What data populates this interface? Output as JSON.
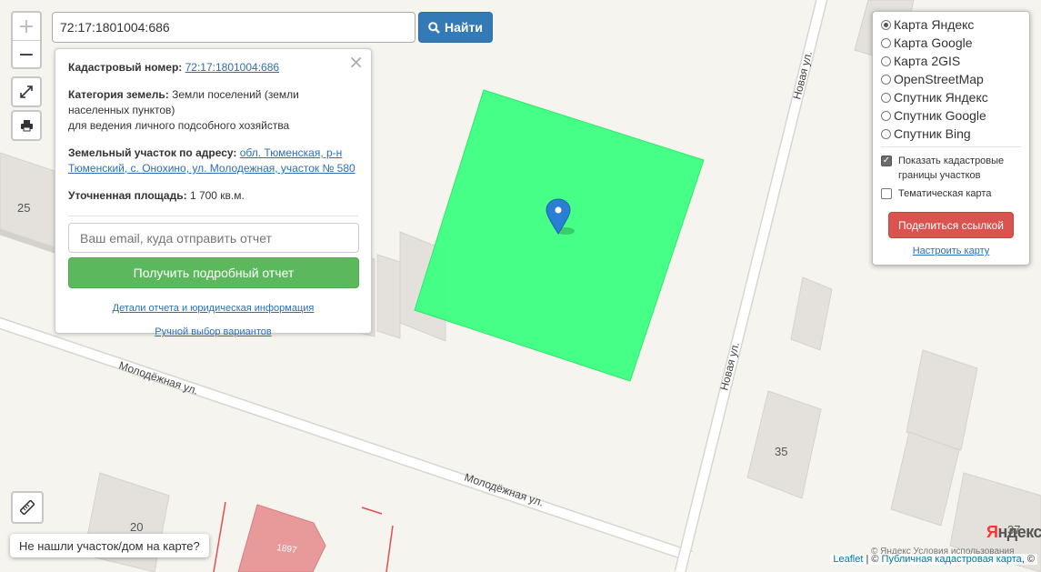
{
  "search": {
    "value": "72:17:1801004:686",
    "button_label": "Найти"
  },
  "zoom": {
    "in_label": "+",
    "out_label": "−"
  },
  "info": {
    "cadastral_label": "Кадастровый номер:",
    "cadastral_value": "72:17:1801004:686",
    "category_label": "Категория земель:",
    "category_value": "Земли поселений (земли населенных пунктов)",
    "category_use": "для ведения личного подсобного хозяйства",
    "address_label": "Земельный участок по адресу:",
    "address_value": "обл. Тюменская, р-н Тюменский, с. Онохино, ул. Молодежная, участок № 580",
    "area_label": "Уточненная площадь:",
    "area_value": "1 700 кв.м.",
    "email_placeholder": "Ваш email, куда отправить отчет",
    "report_button": "Получить подробный отчет",
    "details_link": "Детали отчета и юридическая информация",
    "manual_link": "Ручной выбор вариантов"
  },
  "layers": {
    "options": [
      {
        "label": "Карта Яндекс",
        "selected": true
      },
      {
        "label": "Карта Google",
        "selected": false
      },
      {
        "label": "Карта 2GIS",
        "selected": false
      },
      {
        "label": "OpenStreetMap",
        "selected": false
      },
      {
        "label": "Спутник Яндекс",
        "selected": false
      },
      {
        "label": "Спутник Google",
        "selected": false
      },
      {
        "label": "Спутник Bing",
        "selected": false
      }
    ],
    "show_borders_label": "Показать кадастровые границы участков",
    "show_borders_checked": true,
    "thematic_label": "Тематическая карта",
    "thematic_checked": false,
    "share_button": "Поделиться ссылкой",
    "configure_link": "Настроить карту"
  },
  "map": {
    "streets": [
      "Новая ул.",
      "Новая ул.",
      "Молодёжная ул.",
      "Молодёжная ул."
    ],
    "house_numbers": [
      "25",
      "35",
      "20",
      "37",
      "1897"
    ],
    "parcel_color": "#3cff80",
    "marker_color": "#2a7fd4"
  },
  "not_found_label": "Не нашли участок/дом на карте?",
  "attribution": {
    "leaflet": "Leaflet",
    "sep": " | © ",
    "pkk": "Публичная кадастровая карта",
    "end": ", ©"
  },
  "yandex_logo": {
    "y": "Я",
    "rest": "ндекс"
  },
  "map_terms": "© Яндекс Условия использования"
}
